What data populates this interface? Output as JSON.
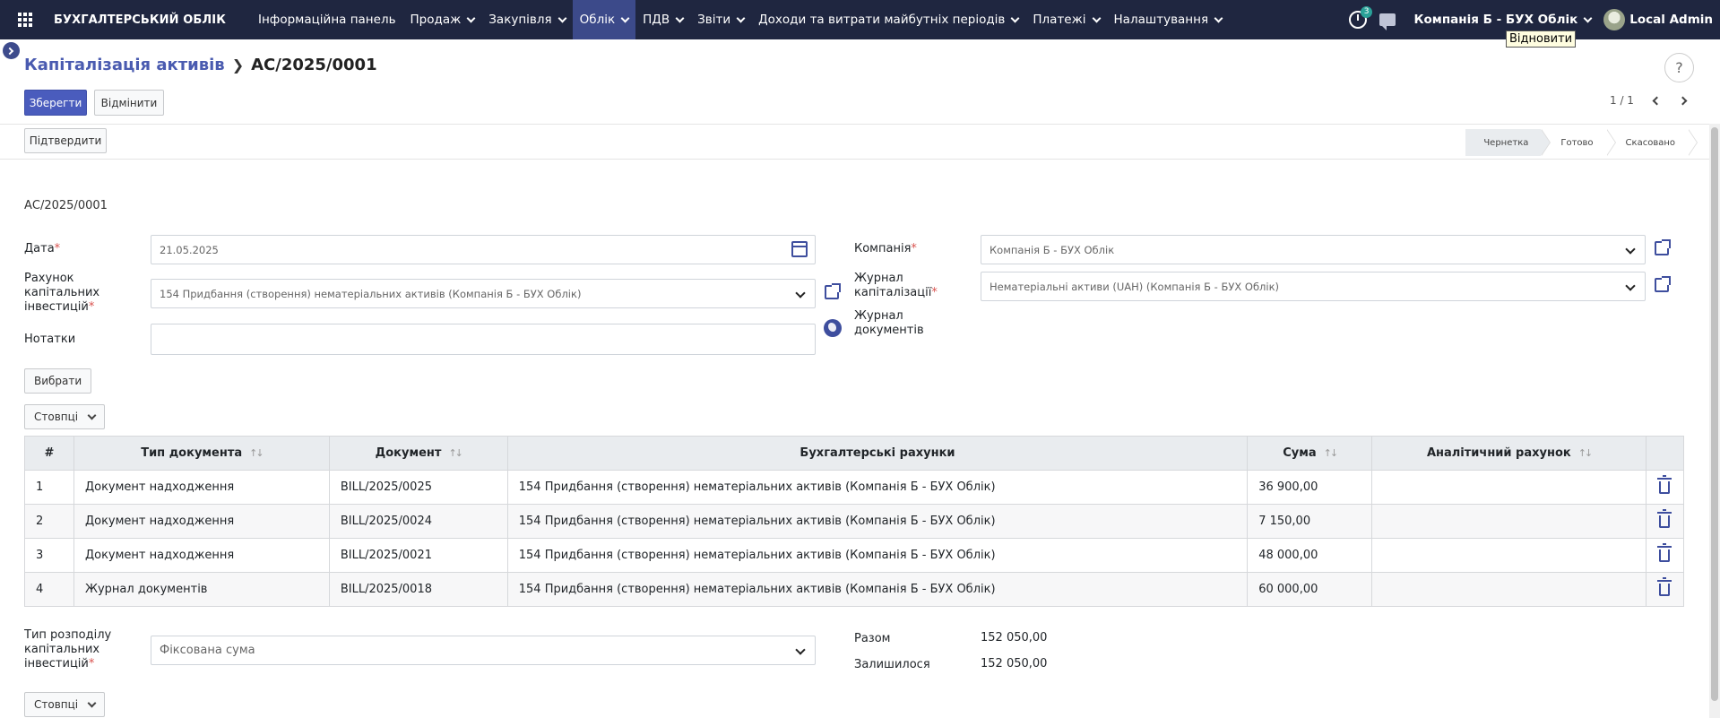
{
  "navbar": {
    "brand": "БУХГАЛТЕРСЬКИЙ ОБЛІК",
    "menu": [
      {
        "label": "Інформаційна панель"
      },
      {
        "label": "Продаж"
      },
      {
        "label": "Закупівля"
      },
      {
        "label": "Облік"
      },
      {
        "label": "ПДВ"
      },
      {
        "label": "Звіти"
      },
      {
        "label": "Доходи та витрати майбутніх періодів"
      },
      {
        "label": "Платежі"
      },
      {
        "label": "Налаштування"
      }
    ],
    "activity_count": "3",
    "company": "Компанія Б - БУХ Облік",
    "user": "Local Admin"
  },
  "tooltip": "Відновити",
  "breadcrumb": {
    "parent": "Капіталізація активів",
    "current": "АС/2025/0001"
  },
  "help": "?",
  "actions": {
    "save": "Зберегти",
    "discard": "Відмінити",
    "confirm": "Підтвердити"
  },
  "pager": "1 / 1",
  "stages": [
    "Чернетка",
    "Готово",
    "Скасовано"
  ],
  "form": {
    "reference": "АС/2025/0001",
    "date_label": "Дата",
    "date_value": "21.05.2025",
    "account_label": "Рахунок капітальних інвестицій",
    "account_value": "154 Придбання (створення) нематеріальних активів (Компанія Б - БУХ Облік)",
    "notes_label": "Нотатки",
    "notes_value": "",
    "company_label": "Компанія",
    "company_value": "Компанія Б - БУХ Облік",
    "journal_label": "Журнал капіталізації",
    "journal_value": "Нематеріальні активи (UAH) (Компанія Б - БУХ Облік)",
    "doc_journal_label": "Журнал документів",
    "select_button": "Вибрати",
    "columns_button": "Стовпці"
  },
  "table": {
    "headers": {
      "num": "#",
      "doc_type": "Тип документа",
      "doc": "Документ",
      "accounts": "Бухгалтерські рахунки",
      "amount": "Сума",
      "analytic": "Аналітичний рахунок"
    },
    "rows": [
      {
        "num": "1",
        "doc_type": "Документ надходження",
        "doc": "BILL/2025/0025",
        "accounts": "154 Придбання (створення) нематеріальних активів (Компанія Б - БУХ Облік)",
        "amount": "36 900,00",
        "analytic": ""
      },
      {
        "num": "2",
        "doc_type": "Документ надходження",
        "doc": "BILL/2025/0024",
        "accounts": "154 Придбання (створення) нематеріальних активів (Компанія Б - БУХ Облік)",
        "amount": "7 150,00",
        "analytic": ""
      },
      {
        "num": "3",
        "doc_type": "Документ надходження",
        "doc": "BILL/2025/0021",
        "accounts": "154 Придбання (створення) нематеріальних активів (Компанія Б - БУХ Облік)",
        "amount": "48 000,00",
        "analytic": ""
      },
      {
        "num": "4",
        "doc_type": "Журнал документів",
        "doc": "BILL/2025/0018",
        "accounts": "154 Придбання (створення) нематеріальних активів (Компанія Б - БУХ Облік)",
        "amount": "60 000,00",
        "analytic": ""
      }
    ]
  },
  "allocation": {
    "type_label": "Тип розподілу капітальних інвестицій",
    "type_value": "Фіксована сума",
    "total_label": "Разом",
    "total_value": "152 050,00",
    "remaining_label": "Залишилося",
    "remaining_value": "152 050,00",
    "columns_button": "Стовпці"
  },
  "colors": {
    "navbar": "#1f2640",
    "accent": "#4a5cbd",
    "active_menu": "#3c4a8a"
  }
}
